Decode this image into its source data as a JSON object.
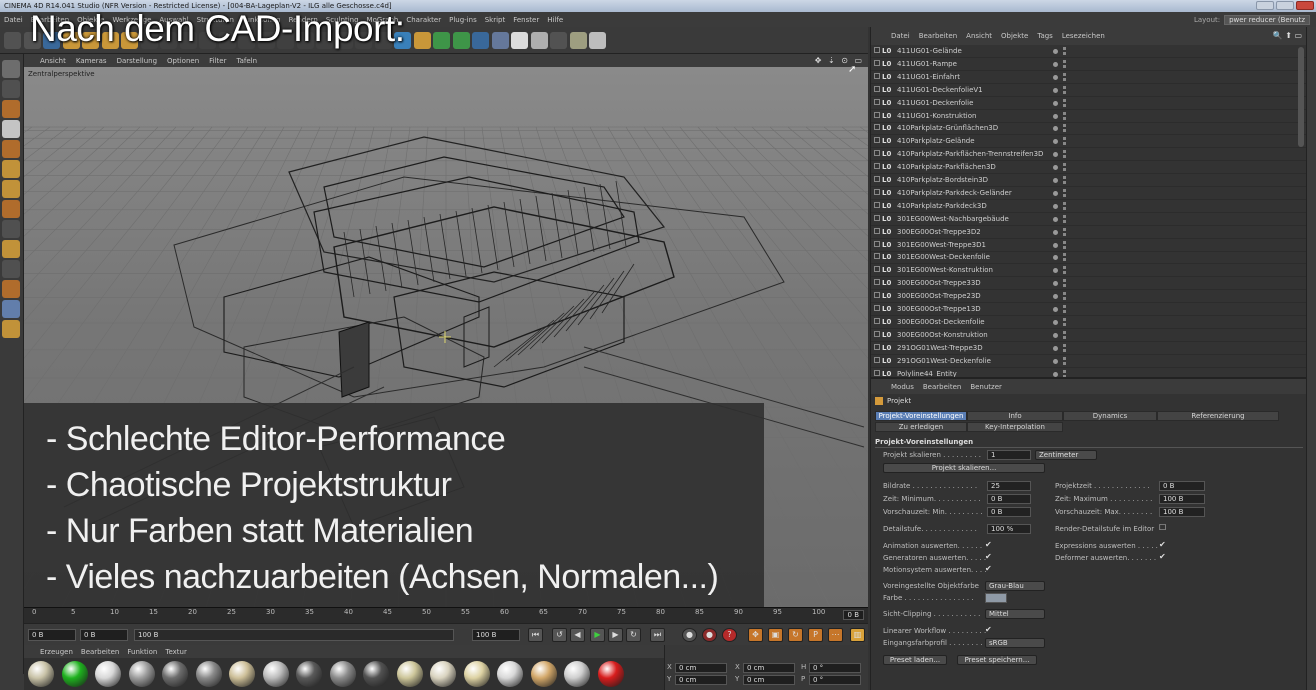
{
  "window": {
    "title": "CINEMA 4D R14.041 Studio (NFR Version - Restricted License) - [004-BA-Lageplan-V2 - ILG alle Geschosse.c4d]"
  },
  "menubar": {
    "items": [
      "Datei",
      "Bearbeiten",
      "Objekte",
      "Werkzeuge",
      "Auswahl",
      "Strukturen",
      "Funktionen",
      "Rendern",
      "Sculpting",
      "MoGraph",
      "Charakter",
      "Plug-ins",
      "Skript",
      "Fenster",
      "Hilfe"
    ]
  },
  "layout": {
    "label": "Layout:",
    "value": "pwer reducer (Benutz"
  },
  "headline": "Nach dem CAD-Import:",
  "viewport": {
    "menu": [
      "Ansicht",
      "Kameras",
      "Darstellung",
      "Optionen",
      "Filter",
      "Tafeln"
    ],
    "label": "Zentralperspektive",
    "nav_icons": "✥ ⇣ ⊙ ▭"
  },
  "bullets": [
    "- Schlechte Editor-Performance",
    "- Chaotische Projektstruktur",
    "- Nur Farben statt Materialien",
    "- Vieles nachzuarbeiten (Achsen, Normalen...)"
  ],
  "timeline": {
    "ticks": [
      "0",
      "5",
      "10",
      "15",
      "20",
      "25",
      "30",
      "35",
      "40",
      "45",
      "50",
      "55",
      "60",
      "65",
      "70",
      "75",
      "80",
      "85",
      "90",
      "95",
      "100"
    ],
    "end_field": "0 B",
    "start_field": "0 B",
    "range_start": "0 B",
    "range_end": "100 B",
    "end_frame": "100 B"
  },
  "materials": {
    "menu": [
      "Erzeugen",
      "Bearbeiten",
      "Funktion",
      "Textur"
    ],
    "colors": [
      "#c9c3a8",
      "#1fb21f",
      "#d8d8d8",
      "#9e9e9e",
      "#6d6d6d",
      "#8a8a8a",
      "#cdbf98",
      "#bdbdbd",
      "#5a5a5a",
      "#8c8c8c",
      "#525252",
      "#cdc69a",
      "#d9d3bf",
      "#ddd2a3",
      "#d8d8d8",
      "#d3a86a",
      "#cfcfcf",
      "#d81d1d"
    ]
  },
  "coords": {
    "rows": [
      {
        "a": "X",
        "av": "0 cm",
        "b": "X",
        "bv": "0 cm",
        "c": "H",
        "cv": "0 °"
      },
      {
        "a": "Y",
        "av": "0 cm",
        "b": "Y",
        "bv": "0 cm",
        "c": "P",
        "cv": "0 °"
      }
    ]
  },
  "object_manager": {
    "menu": [
      "Datei",
      "Bearbeiten",
      "Ansicht",
      "Objekte",
      "Tags",
      "Lesezeichen"
    ],
    "objects": [
      "411UG01-Gelände",
      "411UG01-Rampe",
      "411UG01-Einfahrt",
      "411UG01-DeckenfolieV1",
      "411UG01-Deckenfolie",
      "411UG01-Konstruktion",
      "410Parkplatz-Grünflächen3D",
      "410Parkplatz-Gelände",
      "410Parkplatz-Parkflächen-Trennstreifen3D",
      "410Parkplatz-Parkflächen3D",
      "410Parkplatz-Bordstein3D",
      "410Parkplatz-Parkdeck-Geländer",
      "410Parkplatz-Parkdeck3D",
      "301EG00West-Nachbargebäude",
      "300EG00Ost-Treppe3D2",
      "301EG00West-Treppe3D1",
      "301EG00West-Deckenfolie",
      "301EG00West-Konstruktion",
      "300EG00Ost-Treppe33D",
      "300EG00Ost-Treppe23D",
      "300EG00Ost-Treppe13D",
      "300EG00Ost-Deckenfolie",
      "300EG00Ost-Konstruktion",
      "291OG01West-Treppe3D",
      "291OG01West-Deckenfolie",
      "Polyline44_Entity"
    ]
  },
  "attributes": {
    "menu": [
      "Modus",
      "Bearbeiten",
      "Benutzer"
    ],
    "title": "Projekt",
    "tabs_row1": [
      "Projekt-Voreinstellungen",
      "Info",
      "Dynamics",
      "Referenzierung"
    ],
    "tabs_row2": [
      "Zu erledigen",
      "Key-Interpolation"
    ],
    "section": "Projekt-Voreinstellungen",
    "scale_label": "Projekt skalieren . . . . . . . . .",
    "scale_value": "1",
    "scale_unit": "Zentimeter",
    "scale_button": "Projekt skalieren...",
    "fps_label": "Bildrate . . . . . . . . . . . . . . .",
    "fps_value": "25",
    "projtime_label": "Projektzeit . . . . . . . . . . . . .",
    "projtime_value": "0 B",
    "min_label": "Zeit: Minimum. . . . . . . . . . .",
    "min_value": "0 B",
    "max_label": "Zeit: Maximum . . . . . . . . . .",
    "max_value": "100 B",
    "prevmin_label": "Vorschauzeit: Min. . . . . . . . .",
    "prevmin_value": "0 B",
    "prevmax_label": "Vorschauzeit: Max. . . . . . . .",
    "prevmax_value": "100 B",
    "detail_label": "Detailstufe. . . . . . . . . . . . .",
    "detail_value": "100 %",
    "render_detail_label": "Render-Detailstufe im Editor",
    "anim_label": "Animation auswerten. . . . . .",
    "expr_label": "Expressions auswerten . . . . .",
    "gen_label": "Generatoren auswerten. . . . .",
    "deform_label": "Deformer auswerten. . . . . . .",
    "motion_label": "Motionsystem auswerten. . . .",
    "objcolor_label": "Voreingestellte Objektfarbe",
    "objcolor_value": "Grau-Blau",
    "color_label": "Farbe . . . . . . . . . . . . . . . .",
    "clipping_label": "Sicht-Clipping . . . . . . . . . . .",
    "clipping_value": "Mittel",
    "linear_label": "Linearer Workflow . . . . . . . . .",
    "profile_label": "Eingangsfarbprofil . . . . . . . .",
    "profile_value": "sRGB",
    "preset_load": "Preset laden...",
    "preset_save": "Preset speichern..."
  }
}
